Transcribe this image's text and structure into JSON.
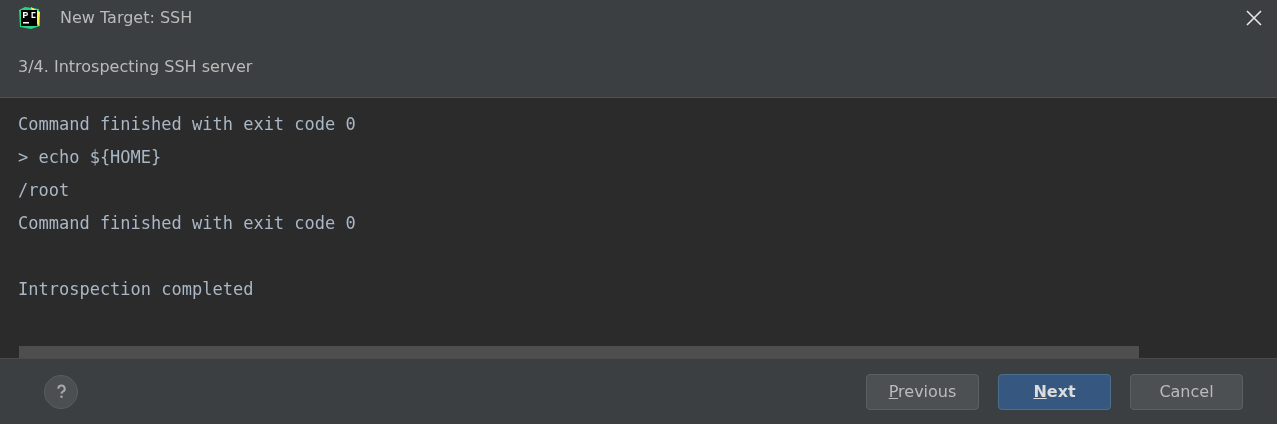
{
  "window": {
    "title": "New Target: SSH"
  },
  "step": "3/4. Introspecting SSH server",
  "console": {
    "blocks": [
      {
        "lines": [
          "Command finished with exit code 0",
          "> echo ${HOME}",
          "/root",
          "Command finished with exit code 0"
        ]
      },
      {
        "lines": [
          "Introspection completed"
        ]
      }
    ]
  },
  "buttons": [
    {
      "label": "Previous",
      "mnemonic": true,
      "default": false
    },
    {
      "label": "Next",
      "mnemonic": true,
      "default": true
    },
    {
      "label": "Cancel",
      "default": false
    }
  ]
}
